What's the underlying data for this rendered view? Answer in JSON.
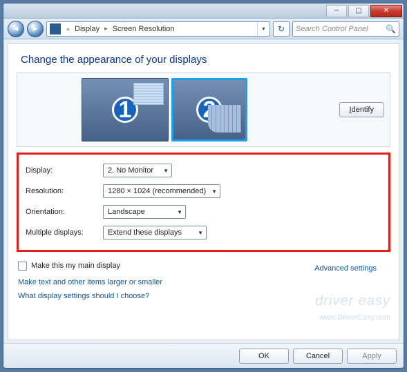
{
  "titlebar": {
    "minimize": "─",
    "maximize": "▢",
    "close": "✕"
  },
  "addressbar": {
    "nav_back": "◄",
    "nav_forward": "►",
    "seg_chevrons": "«",
    "seg1": "Display",
    "seg2": "Screen Resolution",
    "refresh": "↻",
    "search_placeholder": "Search Control Panel",
    "search_icon": "🔍"
  },
  "heading": "Change the appearance of your displays",
  "monitors": {
    "m1": "1",
    "m2": "2"
  },
  "identify_button": "Identify",
  "fields": {
    "display_label": "Display:",
    "display_value": "2. No Monitor",
    "resolution_label": "Resolution:",
    "resolution_value": "1280 × 1024 (recommended)",
    "orientation_label": "Orientation:",
    "orientation_value": "Landscape",
    "multidisp_label": "Multiple displays:",
    "multidisp_value": "Extend these displays"
  },
  "main_display_checkbox": "Make this my main display",
  "advanced_link": "Advanced settings",
  "link1": "Make text and other items larger or smaller",
  "link2": "What display settings should I choose?",
  "buttons": {
    "ok": "OK",
    "cancel": "Cancel",
    "apply": "Apply"
  },
  "watermark": "driver easy",
  "subwatermark": "www.DriverEasy.com"
}
